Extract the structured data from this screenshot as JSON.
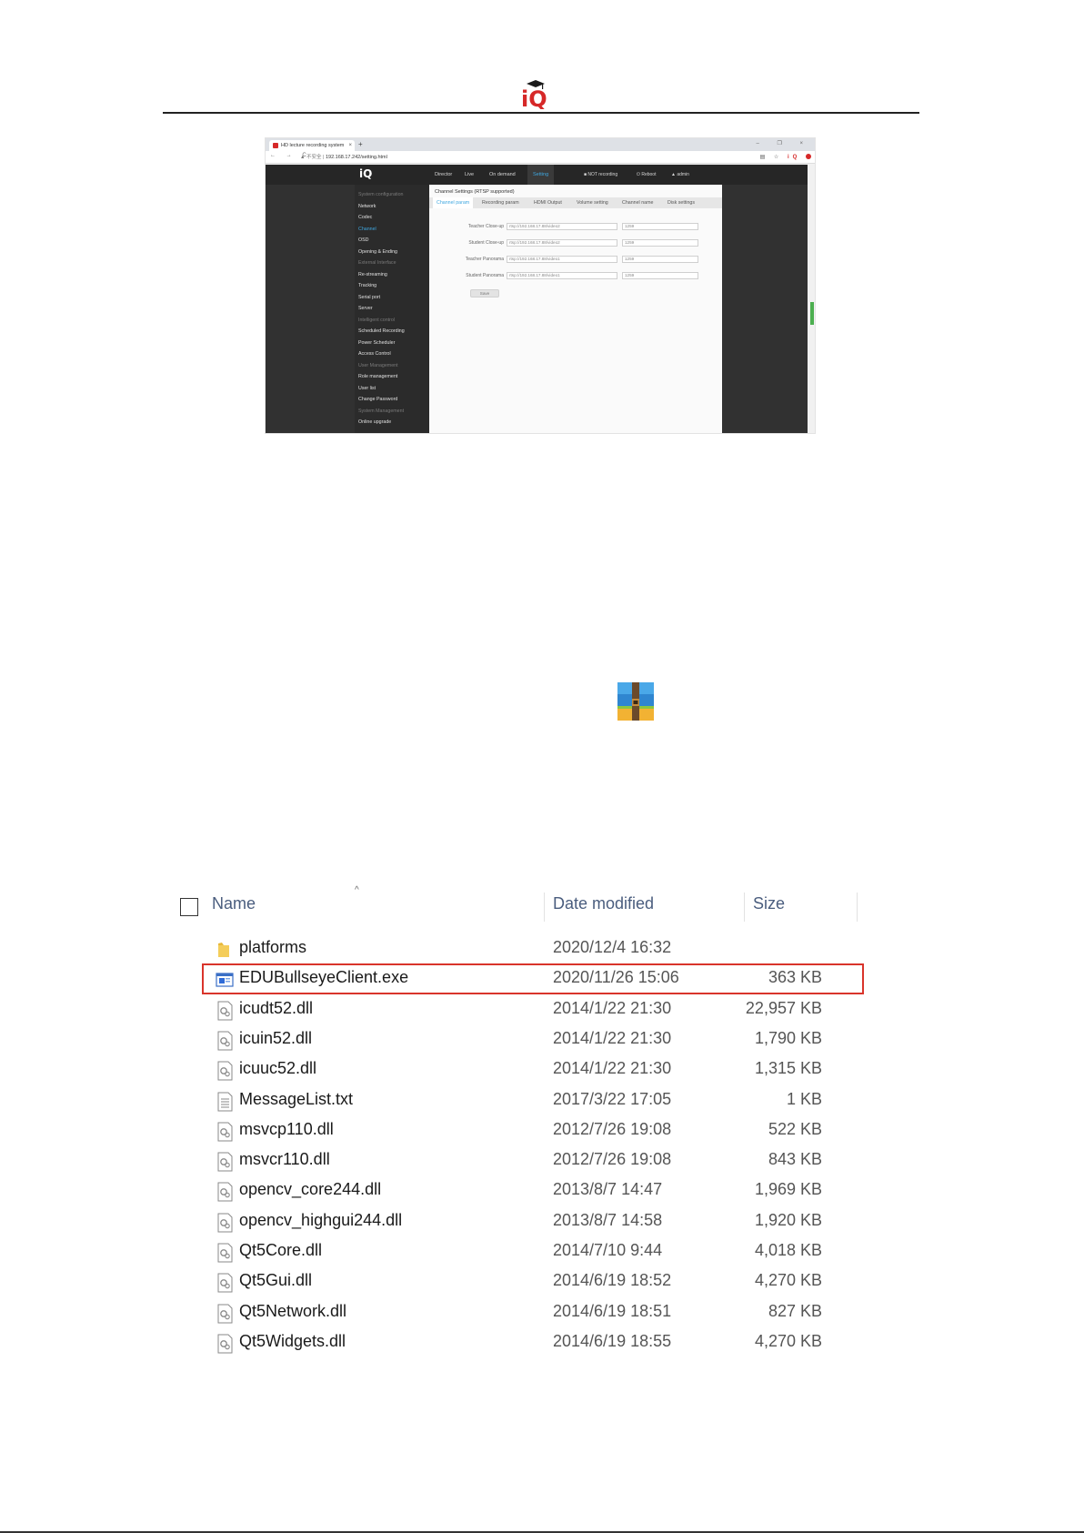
{
  "header": {
    "logo_text": "iQ",
    "logo_icon": "graduation-cap-icon"
  },
  "browser": {
    "tab_title": "HD lecture recording system",
    "tab_close": "×",
    "new_tab": "+",
    "window_controls": "–  ❐  ×",
    "nav_buttons": "←  →  C",
    "security_warning": "▲ 不安全 |",
    "url": "192.168.17.242/setting.html",
    "ext_icons": "▤ ☆",
    "ext_iq": "iQ"
  },
  "app": {
    "logo": "iQ",
    "nav": [
      "Director",
      "Live",
      "On demand",
      "Setting"
    ],
    "status": {
      "recording": "■ NOT recording",
      "reboot": "⏻ Reboot",
      "user": "▲ admin"
    },
    "sidebar": [
      {
        "label": "System configuration",
        "type": "section"
      },
      {
        "label": "Network",
        "type": "item"
      },
      {
        "label": "Codec",
        "type": "item"
      },
      {
        "label": "Channel",
        "type": "active"
      },
      {
        "label": "OSD",
        "type": "item"
      },
      {
        "label": "Opening & Ending",
        "type": "item"
      },
      {
        "label": "External Interface",
        "type": "section"
      },
      {
        "label": "Re-streaming",
        "type": "item"
      },
      {
        "label": "Tracking",
        "type": "item"
      },
      {
        "label": "Serial port",
        "type": "item"
      },
      {
        "label": "Server",
        "type": "item"
      },
      {
        "label": "Intelligent control",
        "type": "section"
      },
      {
        "label": "Scheduled Recording",
        "type": "item"
      },
      {
        "label": "Power Scheduler",
        "type": "item"
      },
      {
        "label": "Access Control",
        "type": "item"
      },
      {
        "label": "User Management",
        "type": "section"
      },
      {
        "label": "Role management",
        "type": "item"
      },
      {
        "label": "User list",
        "type": "item"
      },
      {
        "label": "Change Password",
        "type": "item"
      },
      {
        "label": "System Management",
        "type": "section"
      },
      {
        "label": "Online upgrade",
        "type": "item"
      }
    ],
    "content_title": "Channel Settings (RTSP supported)",
    "tabs": [
      "Channel param",
      "Recording param",
      "HDMI Output",
      "Volume setting",
      "Channel name",
      "Disk settings"
    ],
    "fields": [
      {
        "label": "Teacher Close-up",
        "url": "rtsp://192.168.17.88/video2",
        "value": "1259"
      },
      {
        "label": "Student Close-up",
        "url": "rtsp://192.168.17.88/video2",
        "value": "1259"
      },
      {
        "label": "Teacher Panorama",
        "url": "rtsp://192.168.17.88/video1",
        "value": "1259"
      },
      {
        "label": "Student Panorama",
        "url": "rtsp://192.168.17.88/video1",
        "value": "1259"
      }
    ],
    "save_label": "Save"
  },
  "archive": {
    "icon": "archive-icon"
  },
  "explorer": {
    "columns": {
      "name": "Name",
      "date": "Date modified",
      "size": "Size"
    },
    "sort_indicator": "^",
    "files": [
      {
        "name": "platforms",
        "date": "2020/12/4 16:32",
        "size": "",
        "icon": "folder-icon",
        "highlight": false
      },
      {
        "name": "EDUBullseyeClient.exe",
        "date": "2020/11/26 15:06",
        "size": "363 KB",
        "icon": "exe-icon",
        "highlight": true
      },
      {
        "name": "icudt52.dll",
        "date": "2014/1/22 21:30",
        "size": "22,957 KB",
        "icon": "dll-icon",
        "highlight": false
      },
      {
        "name": "icuin52.dll",
        "date": "2014/1/22 21:30",
        "size": "1,790 KB",
        "icon": "dll-icon",
        "highlight": false
      },
      {
        "name": "icuuc52.dll",
        "date": "2014/1/22 21:30",
        "size": "1,315 KB",
        "icon": "dll-icon",
        "highlight": false
      },
      {
        "name": "MessageList.txt",
        "date": "2017/3/22 17:05",
        "size": "1 KB",
        "icon": "txt-icon",
        "highlight": false
      },
      {
        "name": "msvcp110.dll",
        "date": "2012/7/26 19:08",
        "size": "522 KB",
        "icon": "dll-icon",
        "highlight": false
      },
      {
        "name": "msvcr110.dll",
        "date": "2012/7/26 19:08",
        "size": "843 KB",
        "icon": "dll-icon",
        "highlight": false
      },
      {
        "name": "opencv_core244.dll",
        "date": "2013/8/7 14:47",
        "size": "1,969 KB",
        "icon": "dll-icon",
        "highlight": false
      },
      {
        "name": "opencv_highgui244.dll",
        "date": "2013/8/7 14:58",
        "size": "1,920 KB",
        "icon": "dll-icon",
        "highlight": false
      },
      {
        "name": "Qt5Core.dll",
        "date": "2014/7/10 9:44",
        "size": "4,018 KB",
        "icon": "dll-icon",
        "highlight": false
      },
      {
        "name": "Qt5Gui.dll",
        "date": "2014/6/19 18:52",
        "size": "4,270 KB",
        "icon": "dll-icon",
        "highlight": false
      },
      {
        "name": "Qt5Network.dll",
        "date": "2014/6/19 18:51",
        "size": "827 KB",
        "icon": "dll-icon",
        "highlight": false
      },
      {
        "name": "Qt5Widgets.dll",
        "date": "2014/6/19 18:55",
        "size": "4,270 KB",
        "icon": "dll-icon",
        "highlight": false
      }
    ]
  },
  "colors": {
    "accent": "#3fa7e0",
    "highlight": "#d9342b",
    "brand_red": "#d62828"
  }
}
